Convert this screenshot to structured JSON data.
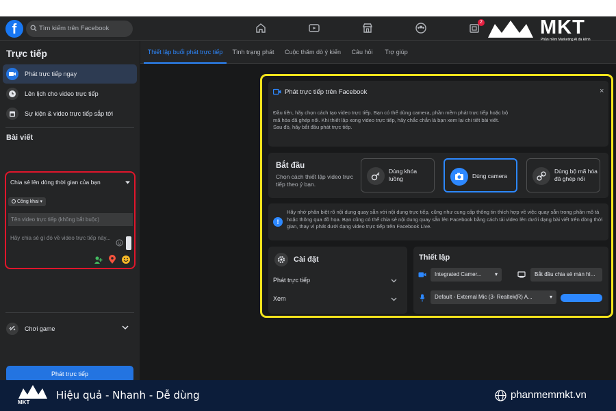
{
  "brand": {
    "name": "MKT",
    "tagline": "Phần mềm Marketing AI đa kênh",
    "footer_slogan": "Hiệu quả - Nhanh - Dễ dùng",
    "website": "phanmemmkt.vn",
    "colors": {
      "footer_bg": "#0c1d3a",
      "fb_blue": "#1877f2",
      "highlight_red": "#e0162b",
      "highlight_yellow": "#f3e31c"
    }
  },
  "navbar": {
    "search_placeholder": "Tìm kiếm trên Facebook",
    "notification_count": "2",
    "icons": [
      "home-icon",
      "watch-icon",
      "marketplace-icon",
      "groups-icon",
      "gaming-icon"
    ]
  },
  "sidebar": {
    "title": "Trực tiếp",
    "items": [
      {
        "label": "Phát trực tiếp ngay",
        "icon": "video-camera-icon",
        "active": true
      },
      {
        "label": "Lên lịch cho video trực tiếp",
        "icon": "clock-icon",
        "active": false
      },
      {
        "label": "Sự kiện & video trực tiếp sắp tới",
        "icon": "calendar-icon",
        "active": false
      }
    ],
    "post_section_title": "Bài viết",
    "post": {
      "share_to": "Chia sẻ lên dòng thời gian của bạn",
      "audience": "Công khai",
      "title_placeholder": "Tên video trực tiếp (không bắt buộc)",
      "description_placeholder": "Hãy chia sẻ gì đó về video trực tiếp này..."
    },
    "game_label": "Chơi game",
    "go_live_button": "Phát trực tiếp"
  },
  "tabs": [
    "Thiết lập buổi phát trực tiếp",
    "Tình trạng phát",
    "Cuộc thăm dò ý kiến",
    "Câu hỏi",
    "Trợ giúp"
  ],
  "active_tab": 0,
  "panel": {
    "title": "Phát trực tiếp trên Facebook",
    "intro": "Đầu tiên, hãy chọn cách tạo video trực tiếp. Bạn có thể dùng camera, phần mềm phát trực tiếp hoặc bộ mã hóa đã ghép nối. Khi thiết lập xong video trực tiếp, hãy chắc chắn là bạn xem lại chi tiết bài viết. Sau đó, hãy bắt đầu phát trực tiếp.",
    "start": {
      "title": "Bắt đầu",
      "subtitle": "Chọn cách thiết lập video trực tiếp theo ý bạn.",
      "options": [
        {
          "label": "Dùng khóa luồng",
          "icon": "key-icon",
          "selected": false
        },
        {
          "label": "Dùng camera",
          "icon": "camera-icon",
          "selected": true
        },
        {
          "label": "Dùng bộ mã hóa đã ghép nối",
          "icon": "link-icon",
          "selected": false
        }
      ]
    },
    "notice": "Hãy nhớ phân biệt rõ nội dung quay sẵn với nội dung trực tiếp, cũng như cung cấp thông tin thích hợp về việc quay sẵn trong phần mô tả hoặc thông qua đồ họa. Bạn cũng có thể chia sẻ nội dung quay sẵn lên Facebook bằng cách tải video lên dưới dạng bài viết trên dòng thời gian, thay vì phát dưới dạng video trực tiếp trên Facebook Live.",
    "settings": {
      "title": "Cài đặt",
      "rows": [
        "Phát trực tiếp",
        "Xem"
      ]
    },
    "setup": {
      "title": "Thiết lập",
      "camera_select": "Integrated Camer...",
      "screen_share": "Bắt đầu chia sẻ màn hì...",
      "mic_select": "Default - External Mic (3- Realtek(R) A..."
    }
  }
}
